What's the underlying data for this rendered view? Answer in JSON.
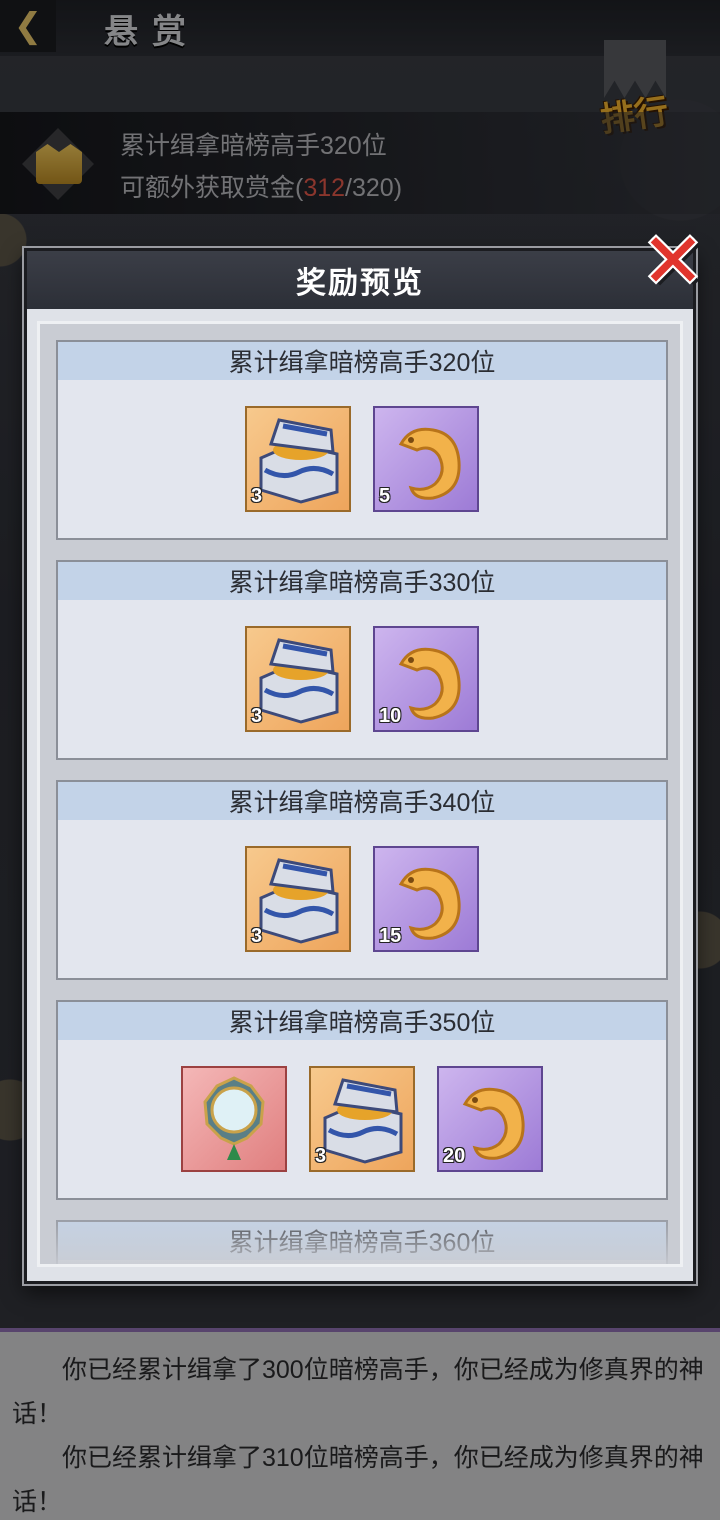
{
  "header": {
    "back_icon": "chevron-left-icon",
    "title": "悬赏",
    "rank_label": "排行"
  },
  "info": {
    "line1": "累计缉拿暗榜高手320位",
    "line2_prefix": "可额外获取赏金(",
    "current": "312",
    "separator": "/",
    "total": "320",
    "line2_suffix": ")",
    "accent_color": "#e0574a"
  },
  "modal": {
    "title": "奖励预览",
    "close_icon": "close-x-icon",
    "rewards": [
      {
        "title": "累计缉拿暗榜高手320位",
        "items": [
          {
            "kind": "treasure-chest-icon",
            "rarity": "orange",
            "qty": "3"
          },
          {
            "kind": "gold-jade-dragon-icon",
            "rarity": "purple",
            "qty": "5"
          }
        ]
      },
      {
        "title": "累计缉拿暗榜高手330位",
        "items": [
          {
            "kind": "treasure-chest-icon",
            "rarity": "orange",
            "qty": "3"
          },
          {
            "kind": "gold-jade-dragon-icon",
            "rarity": "purple",
            "qty": "10"
          }
        ]
      },
      {
        "title": "累计缉拿暗榜高手340位",
        "items": [
          {
            "kind": "treasure-chest-icon",
            "rarity": "orange",
            "qty": "3"
          },
          {
            "kind": "gold-jade-dragon-icon",
            "rarity": "purple",
            "qty": "15"
          }
        ]
      },
      {
        "title": "累计缉拿暗榜高手350位",
        "items": [
          {
            "kind": "magic-mirror-icon",
            "rarity": "red",
            "qty": ""
          },
          {
            "kind": "treasure-chest-icon",
            "rarity": "orange",
            "qty": "3"
          },
          {
            "kind": "gold-jade-dragon-icon",
            "rarity": "purple",
            "qty": "20"
          }
        ]
      },
      {
        "title": "累计缉拿暗榜高手360位",
        "items": []
      }
    ]
  },
  "story": {
    "lines": [
      "你已经累计缉拿了300位暗榜高手，你已经成为修真界的神话！",
      "你已经累计缉拿了310位暗榜高手，你已经成为修真界的神话！"
    ]
  }
}
